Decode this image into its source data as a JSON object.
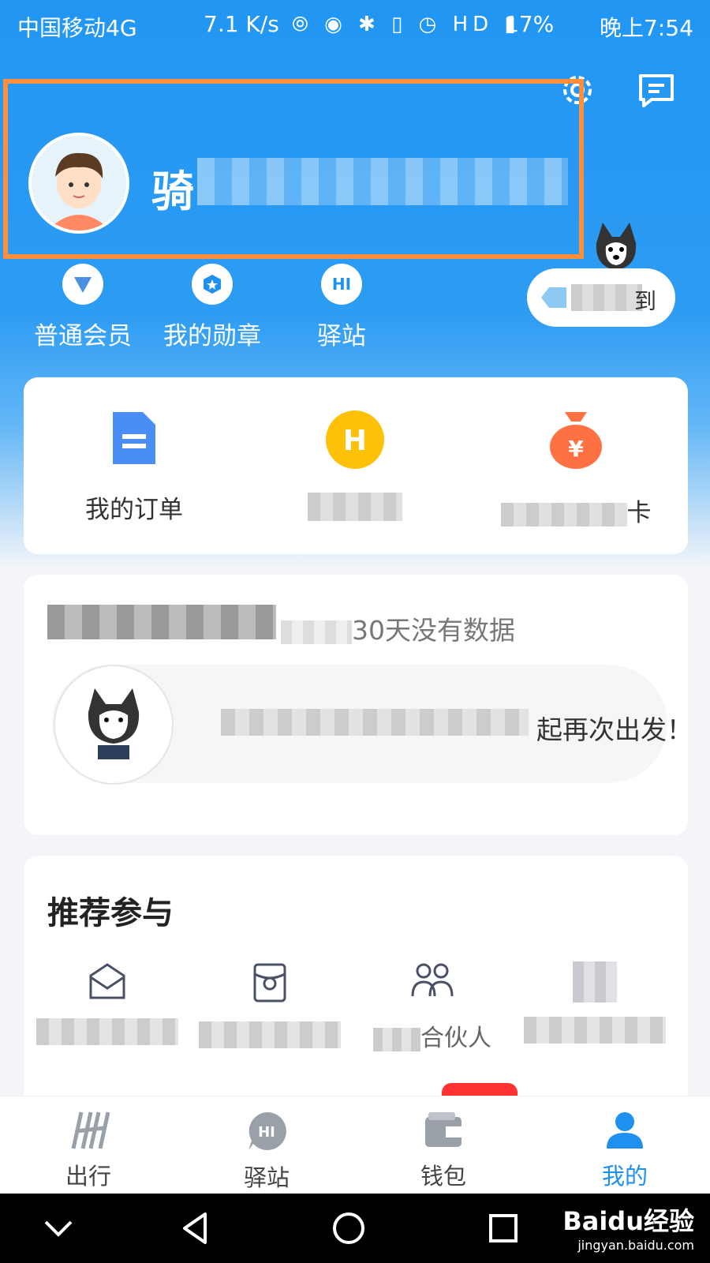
{
  "status_bar": {
    "carrier": "中国移动4G",
    "speed": "7.1 K/s",
    "icons": "⦾ ◉ ✱ ▯ ◷ HD ▮",
    "battery": "17%",
    "time": "晚上7:54"
  },
  "profile": {
    "username": "骑"
  },
  "quick_links": [
    {
      "label": "普通会员",
      "icon": "member-triangle-icon"
    },
    {
      "label": "我的勋章",
      "icon": "medal-icon"
    },
    {
      "label": "驿站",
      "icon": "hi-icon"
    }
  ],
  "sign_pill": {
    "text": "到"
  },
  "services": [
    {
      "label": "我的订单",
      "icon": "document-icon"
    },
    {
      "label": "",
      "icon": "h-coin-icon"
    },
    {
      "label": "卡",
      "icon": "money-bag-icon"
    }
  ],
  "trip": {
    "notice": "30天没有数据",
    "message": "起再次出发！"
  },
  "recommend": {
    "title": "推荐参与",
    "items": [
      {
        "label": "",
        "icon": "envelope-icon"
      },
      {
        "label": "",
        "icon": "red-packet-icon"
      },
      {
        "label": "合伙人",
        "icon": "partners-icon"
      },
      {
        "label": "",
        "icon": "blurred-icon"
      }
    ]
  },
  "tabs": [
    {
      "label": "出行",
      "icon": "hellobike-logo-icon",
      "active": false
    },
    {
      "label": "驿站",
      "icon": "hi-chat-icon",
      "active": false
    },
    {
      "label": "钱包",
      "icon": "wallet-icon",
      "active": false
    },
    {
      "label": "我的",
      "icon": "person-icon",
      "active": true
    }
  ],
  "watermark": {
    "brand": "Baidu经验",
    "url": "jingyan.baidu.com"
  },
  "colors": {
    "primary": "#1e90f0",
    "highlight_border": "#ff8f3a",
    "coin": "#ffc107",
    "bag": "#ff7043"
  }
}
